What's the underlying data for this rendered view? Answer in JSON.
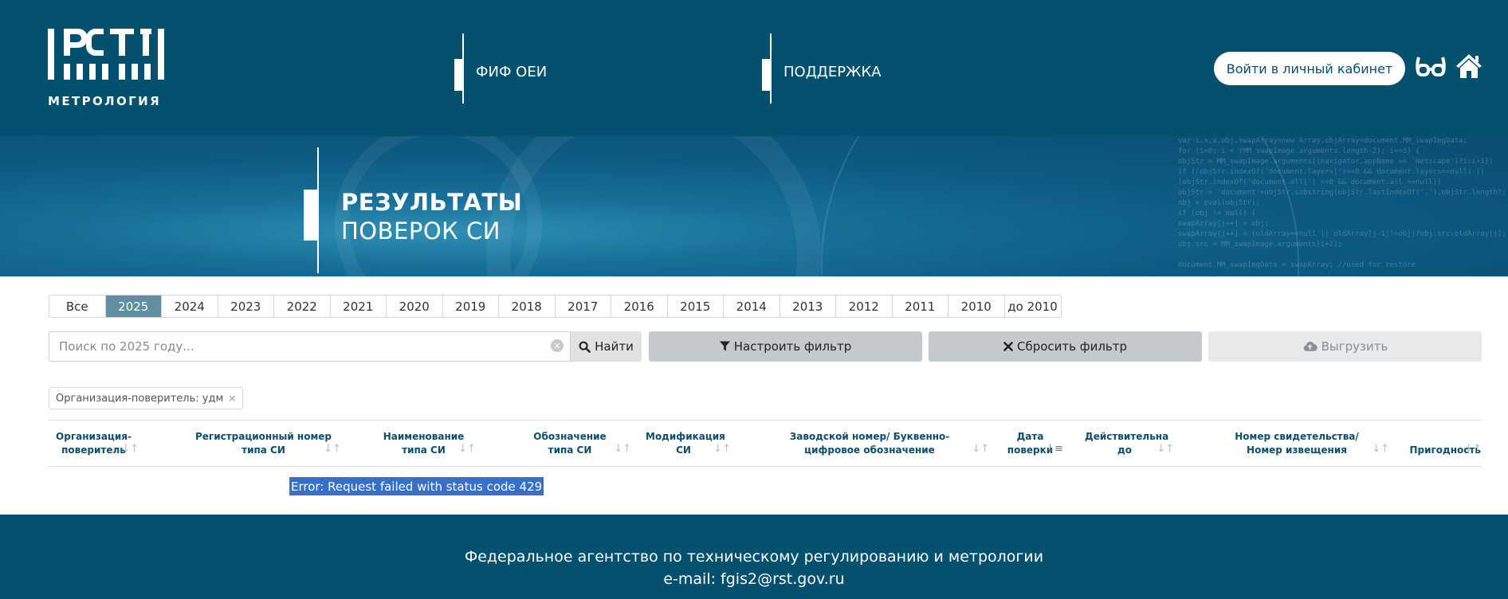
{
  "header": {
    "logo_text": "РСТ",
    "logo_subtitle": "МЕТРОЛОГИЯ",
    "nav": [
      {
        "label": "ФИФ ОЕИ"
      },
      {
        "label": "ПОДДЕРЖКА"
      }
    ],
    "login_label": "Войти в личный кабинет",
    "icons": {
      "accessibility": "glasses-icon",
      "home": "home-icon"
    }
  },
  "banner": {
    "title_line1": "РЕЗУЛЬТАТЫ",
    "title_line2": "ПОВЕРОК СИ"
  },
  "years": {
    "items": [
      "Все",
      "2025",
      "2024",
      "2023",
      "2022",
      "2021",
      "2020",
      "2019",
      "2018",
      "2017",
      "2016",
      "2015",
      "2014",
      "2013",
      "2012",
      "2011",
      "2010",
      "до 2010"
    ],
    "active": "2025"
  },
  "search": {
    "placeholder": "Поиск по 2025 году...",
    "value": "",
    "find_label": "Найти"
  },
  "toolbar": {
    "filter_label": "Настроить фильтр",
    "reset_label": "Сбросить фильтр",
    "export_label": "Выгрузить"
  },
  "chip": {
    "label": "Организация-поверитель: удм",
    "remove": "×"
  },
  "table": {
    "columns": [
      "Организация-поверитель",
      "Регистрационный номер типа СИ",
      "Наименование типа СИ",
      "Обозначение типа СИ",
      "Модификация СИ",
      "Заводской номер/ Буквенно-цифровое обозначение",
      "Дата поверки",
      "Действительна до",
      "Номер свидетельства/ Номер извещения",
      "Пригодность"
    ],
    "error": "Error: Request failed with status code 429"
  },
  "footer": {
    "org": "Федеральное агентство по техническому регулированию и метрологии",
    "email": "e-mail: fgis2@rst.gov.ru"
  },
  "colors": {
    "brand": "#03506f",
    "active_year": "#5f8fa3",
    "button_gray": "#c4c9cd",
    "selection": "#3770c8"
  }
}
